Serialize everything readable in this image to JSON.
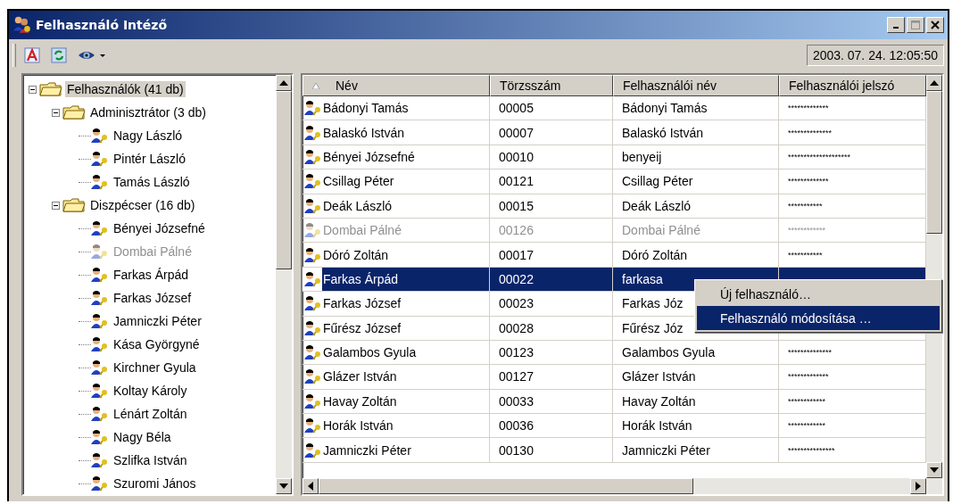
{
  "window": {
    "title": "Felhasználó Intéző",
    "controls": [
      {
        "kind": "minimize",
        "disabled": false
      },
      {
        "kind": "maximize",
        "disabled": true
      },
      {
        "kind": "close",
        "disabled": false
      }
    ]
  },
  "toolbar": {
    "buttons": [
      {
        "kind": "font"
      },
      {
        "kind": "refresh"
      },
      {
        "kind": "view"
      }
    ],
    "datetime": "2003. 07. 24. 12:05:50"
  },
  "tree": {
    "items": [
      {
        "label": "Felhasználók (41 db)",
        "kind": "folder",
        "expanded": true,
        "selected": true,
        "disabled": false,
        "children": [
          {
            "label": "Adminisztrátor (3 db)",
            "kind": "folder",
            "expanded": true,
            "selected": false,
            "disabled": false,
            "children": [
              {
                "label": "Nagy László",
                "kind": "user",
                "selected": false,
                "disabled": false
              },
              {
                "label": "Pintér László",
                "kind": "user",
                "selected": false,
                "disabled": false
              },
              {
                "label": "Tamás László",
                "kind": "user",
                "selected": false,
                "disabled": false
              }
            ]
          },
          {
            "label": "Diszpécser (16 db)",
            "kind": "folder",
            "expanded": true,
            "selected": false,
            "disabled": false,
            "children": [
              {
                "label": "Bényei Józsefné",
                "kind": "user",
                "selected": false,
                "disabled": false
              },
              {
                "label": "Dombai Pálné",
                "kind": "user",
                "selected": false,
                "disabled": true
              },
              {
                "label": "Farkas Árpád",
                "kind": "user",
                "selected": false,
                "disabled": false
              },
              {
                "label": "Farkas József",
                "kind": "user",
                "selected": false,
                "disabled": false
              },
              {
                "label": "Jamniczki Péter",
                "kind": "user",
                "selected": false,
                "disabled": false
              },
              {
                "label": "Kása Györgyné",
                "kind": "user",
                "selected": false,
                "disabled": false
              },
              {
                "label": "Kirchner Gyula",
                "kind": "user",
                "selected": false,
                "disabled": false
              },
              {
                "label": "Koltay Károly",
                "kind": "user",
                "selected": false,
                "disabled": false
              },
              {
                "label": "Lénárt Zoltán",
                "kind": "user",
                "selected": false,
                "disabled": false
              },
              {
                "label": "Nagy Béla",
                "kind": "user",
                "selected": false,
                "disabled": false
              },
              {
                "label": "Szlifka István",
                "kind": "user",
                "selected": false,
                "disabled": false
              },
              {
                "label": "Szuromi János",
                "kind": "user",
                "selected": false,
                "disabled": false
              }
            ]
          }
        ]
      }
    ]
  },
  "table": {
    "columns": [
      "Név",
      "Törzsszám",
      "Felhasználói név",
      "Felhasználói jelszó"
    ],
    "rows": [
      {
        "cells": [
          "Bádonyi Tamás",
          "00005",
          "Bádonyi Tamás",
          "*************"
        ],
        "selected": false,
        "disabled": false
      },
      {
        "cells": [
          "Balaskó István",
          "00007",
          "Balaskó István",
          "**************"
        ],
        "selected": false,
        "disabled": false
      },
      {
        "cells": [
          "Bényei Józsefné",
          "00010",
          "benyeij",
          "********************"
        ],
        "selected": false,
        "disabled": false
      },
      {
        "cells": [
          "Csillag Péter",
          "00121",
          "Csillag Péter",
          "*************"
        ],
        "selected": false,
        "disabled": false
      },
      {
        "cells": [
          "Deák László",
          "00015",
          "Deák László",
          "***********"
        ],
        "selected": false,
        "disabled": false
      },
      {
        "cells": [
          "Dombai Pálné",
          "00126",
          "Dombai Pálné",
          "************"
        ],
        "selected": false,
        "disabled": true
      },
      {
        "cells": [
          "Dóró Zoltán",
          "00017",
          "Dóró Zoltán",
          "***********"
        ],
        "selected": false,
        "disabled": false
      },
      {
        "cells": [
          "Farkas Árpád",
          "00022",
          "farkasa"
        ],
        "selected": true,
        "disabled": false
      },
      {
        "cells": [
          "Farkas József",
          "00023",
          "Farkas Józ"
        ],
        "selected": false,
        "disabled": false
      },
      {
        "cells": [
          "Fűrész József",
          "00028",
          "Fűrész Józ"
        ],
        "selected": false,
        "disabled": false
      },
      {
        "cells": [
          "Galambos Gyula",
          "00123",
          "Galambos Gyula",
          "**************"
        ],
        "selected": false,
        "disabled": false
      },
      {
        "cells": [
          "Glázer István",
          "00127",
          "Glázer István",
          "*************"
        ],
        "selected": false,
        "disabled": false
      },
      {
        "cells": [
          "Havay Zoltán",
          "00033",
          "Havay Zoltán",
          "************"
        ],
        "selected": false,
        "disabled": false
      },
      {
        "cells": [
          "Horák István",
          "00036",
          "Horák István",
          "************"
        ],
        "selected": false,
        "disabled": false
      },
      {
        "cells": [
          "Jamniczki Péter",
          "00130",
          "Jamniczki Péter",
          "***************"
        ],
        "selected": false,
        "disabled": false
      }
    ]
  },
  "context_menu": {
    "items": [
      {
        "label": "Új felhasználó…",
        "selected": false
      },
      {
        "label": "Felhasználó módosítása …",
        "selected": true
      }
    ]
  }
}
